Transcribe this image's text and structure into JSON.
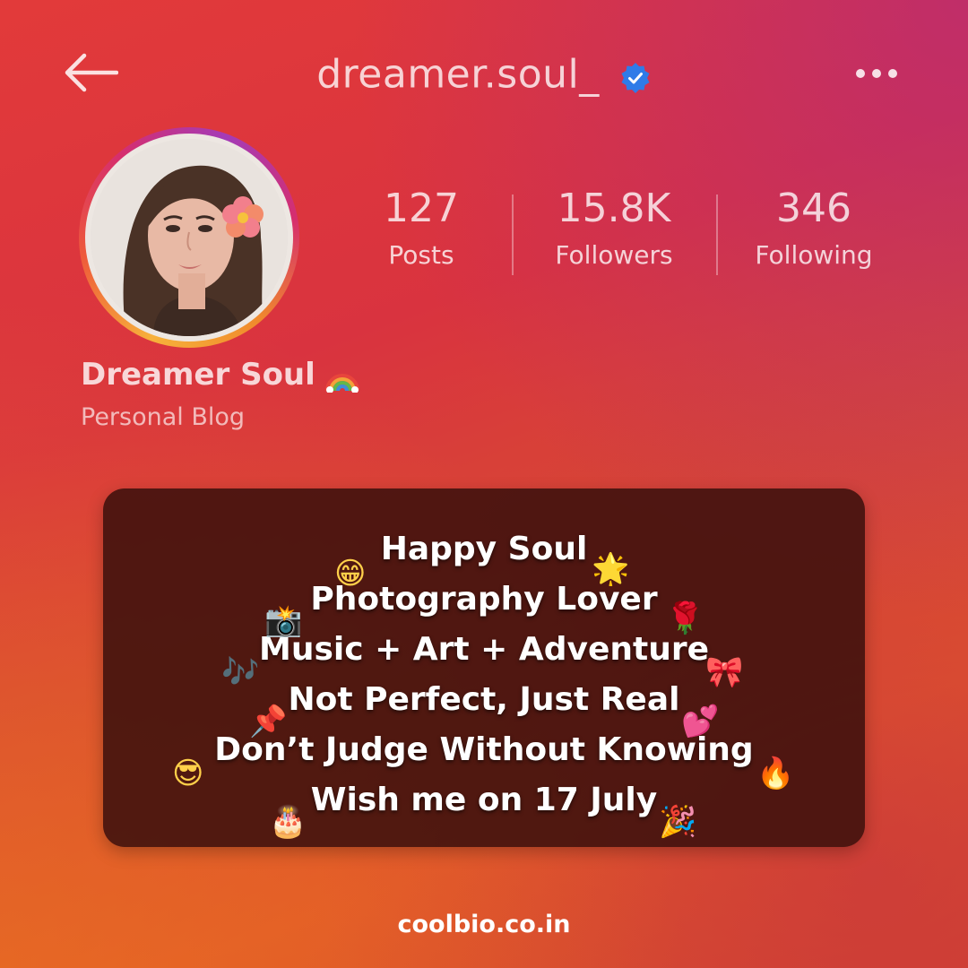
{
  "header": {
    "username": "dreamer.soul_",
    "back_icon": "arrow-left-icon",
    "verified_icon": "verified-badge-icon",
    "more_icon": "more-dots-icon"
  },
  "profile": {
    "display_name": "Dreamer Soul",
    "name_emoji": "rainbow-icon",
    "category": "Personal Blog"
  },
  "stats": [
    {
      "value": "127",
      "label": "Posts"
    },
    {
      "value": "15.8K",
      "label": "Followers"
    },
    {
      "value": "346",
      "label": "Following"
    }
  ],
  "bio": {
    "lines": [
      "Happy Soul",
      "Photography Lover",
      "Music + Art + Adventure",
      "Not Perfect, Just Real",
      "Don’t Judge Without Knowing",
      "Wish me on 17 July"
    ],
    "emojis": {
      "grin": "😁",
      "sparkle": "🌟",
      "camera": "📸",
      "rose": "🌹",
      "music": "🎶",
      "ribbon": "🎀",
      "pin": "📌",
      "hearts": "💕",
      "sunglasses": "😎",
      "fire": "🔥",
      "cake": "🎂",
      "party": "🎉"
    }
  },
  "footer": {
    "site": "coolbio.co.in"
  },
  "colors": {
    "verified": "#2f7be8",
    "card_bg": "#3c100c",
    "text_light": "#ffffff"
  }
}
